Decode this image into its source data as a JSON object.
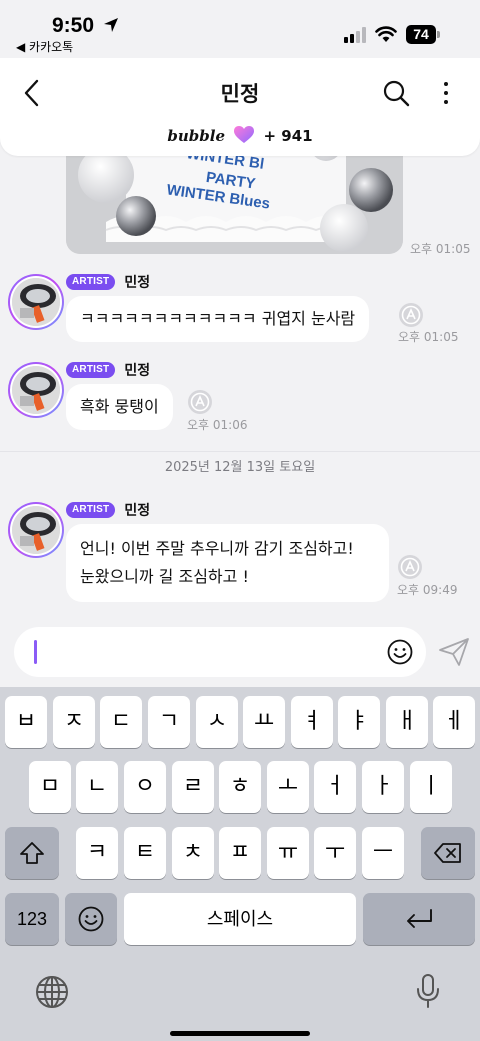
{
  "status": {
    "time": "9:50",
    "back_app": "◀ 카카오톡",
    "battery": "74"
  },
  "header": {
    "title": "민정",
    "bubble_logo": "bubble",
    "count": "+ 941"
  },
  "image_message": {
    "cake_text": [
      "WINTER Bl",
      "PARTY",
      "WINTER Blues"
    ],
    "time": "오후 01:05"
  },
  "messages": [
    {
      "badge": "ARTIST",
      "sender": "민정",
      "text": "ㅋㅋㅋㅋㅋㅋㅋㅋㅋㅋㅋㅋ 귀엽지 눈사람",
      "time": "오후 01:05"
    },
    {
      "badge": "ARTIST",
      "sender": "민정",
      "text": "흑화 뭉탱이",
      "time": "오후 01:06"
    },
    {
      "badge": "ARTIST",
      "sender": "민정",
      "lines": [
        "언니! 이번 주말 추우니까 감기 조심하고!",
        "눈왔으니까 길 조심하고 !"
      ],
      "time": "오후 09:49"
    }
  ],
  "date_divider": "2025년 12월 13일 토요일",
  "input": {
    "value": ""
  },
  "keyboard": {
    "row1": [
      "ㅂ",
      "ㅈ",
      "ㄷ",
      "ㄱ",
      "ㅅ",
      "ㅛ",
      "ㅕ",
      "ㅑ",
      "ㅐ",
      "ㅔ"
    ],
    "row2": [
      "ㅁ",
      "ㄴ",
      "ㅇ",
      "ㄹ",
      "ㅎ",
      "ㅗ",
      "ㅓ",
      "ㅏ",
      "ㅣ"
    ],
    "row3": [
      "ㅋ",
      "ㅌ",
      "ㅊ",
      "ㅍ",
      "ㅠ",
      "ㅜ",
      "ㅡ"
    ],
    "numbers": "123",
    "space": "스페이스"
  },
  "colors": {
    "accent": "#7a4df0",
    "caret": "#8b5cf6",
    "bubble_bg": "#ffffff",
    "chat_bg": "#f2f2f4"
  }
}
